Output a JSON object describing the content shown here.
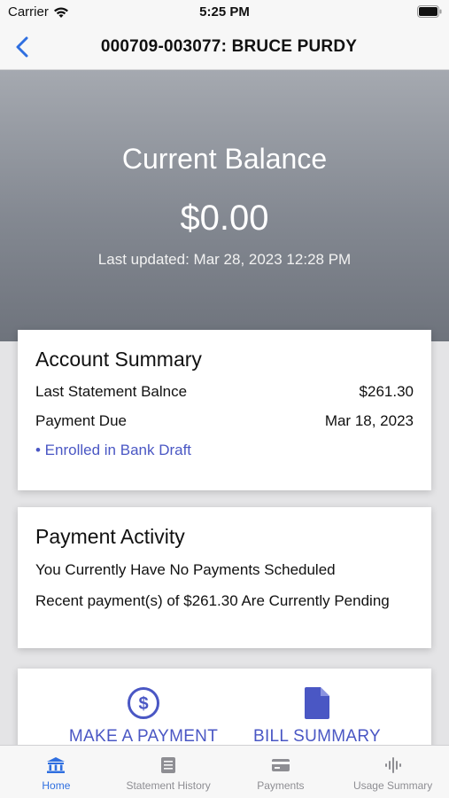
{
  "status_bar": {
    "carrier": "Carrier",
    "time": "5:25 PM"
  },
  "nav": {
    "title": "000709-003077: BRUCE PURDY",
    "back_icon": "chevron-left-icon"
  },
  "hero": {
    "title": "Current Balance",
    "amount": "$0.00",
    "last_updated": "Last updated: Mar 28, 2023 12:28 PM"
  },
  "account_summary": {
    "title": "Account Summary",
    "rows": [
      {
        "label": "Last Statement Balnce",
        "value": "$261.30"
      },
      {
        "label": "Payment Due",
        "value": "Mar 18, 2023"
      }
    ],
    "enrolled": "• Enrolled in Bank Draft"
  },
  "payment_activity": {
    "title": "Payment Activity",
    "line1": "You Currently Have No Payments Scheduled",
    "line2": "Recent payment(s) of $261.30 Are Currently Pending"
  },
  "actions": [
    {
      "label": "MAKE A PAYMENT",
      "icon": "dollar-circle-icon"
    },
    {
      "label": "BILL SUMMARY",
      "icon": "document-icon"
    }
  ],
  "tabs": [
    {
      "label": "Home",
      "icon": "bank-icon",
      "active": true
    },
    {
      "label": "Statement History",
      "icon": "list-document-icon",
      "active": false
    },
    {
      "label": "Payments",
      "icon": "credit-card-icon",
      "active": false
    },
    {
      "label": "Usage Summary",
      "icon": "waveform-icon",
      "active": false
    }
  ],
  "colors": {
    "accent": "#4a57c4",
    "tab_active": "#2f6fe0",
    "hero_top": "#a5a9b0",
    "hero_bottom": "#6e737c"
  }
}
